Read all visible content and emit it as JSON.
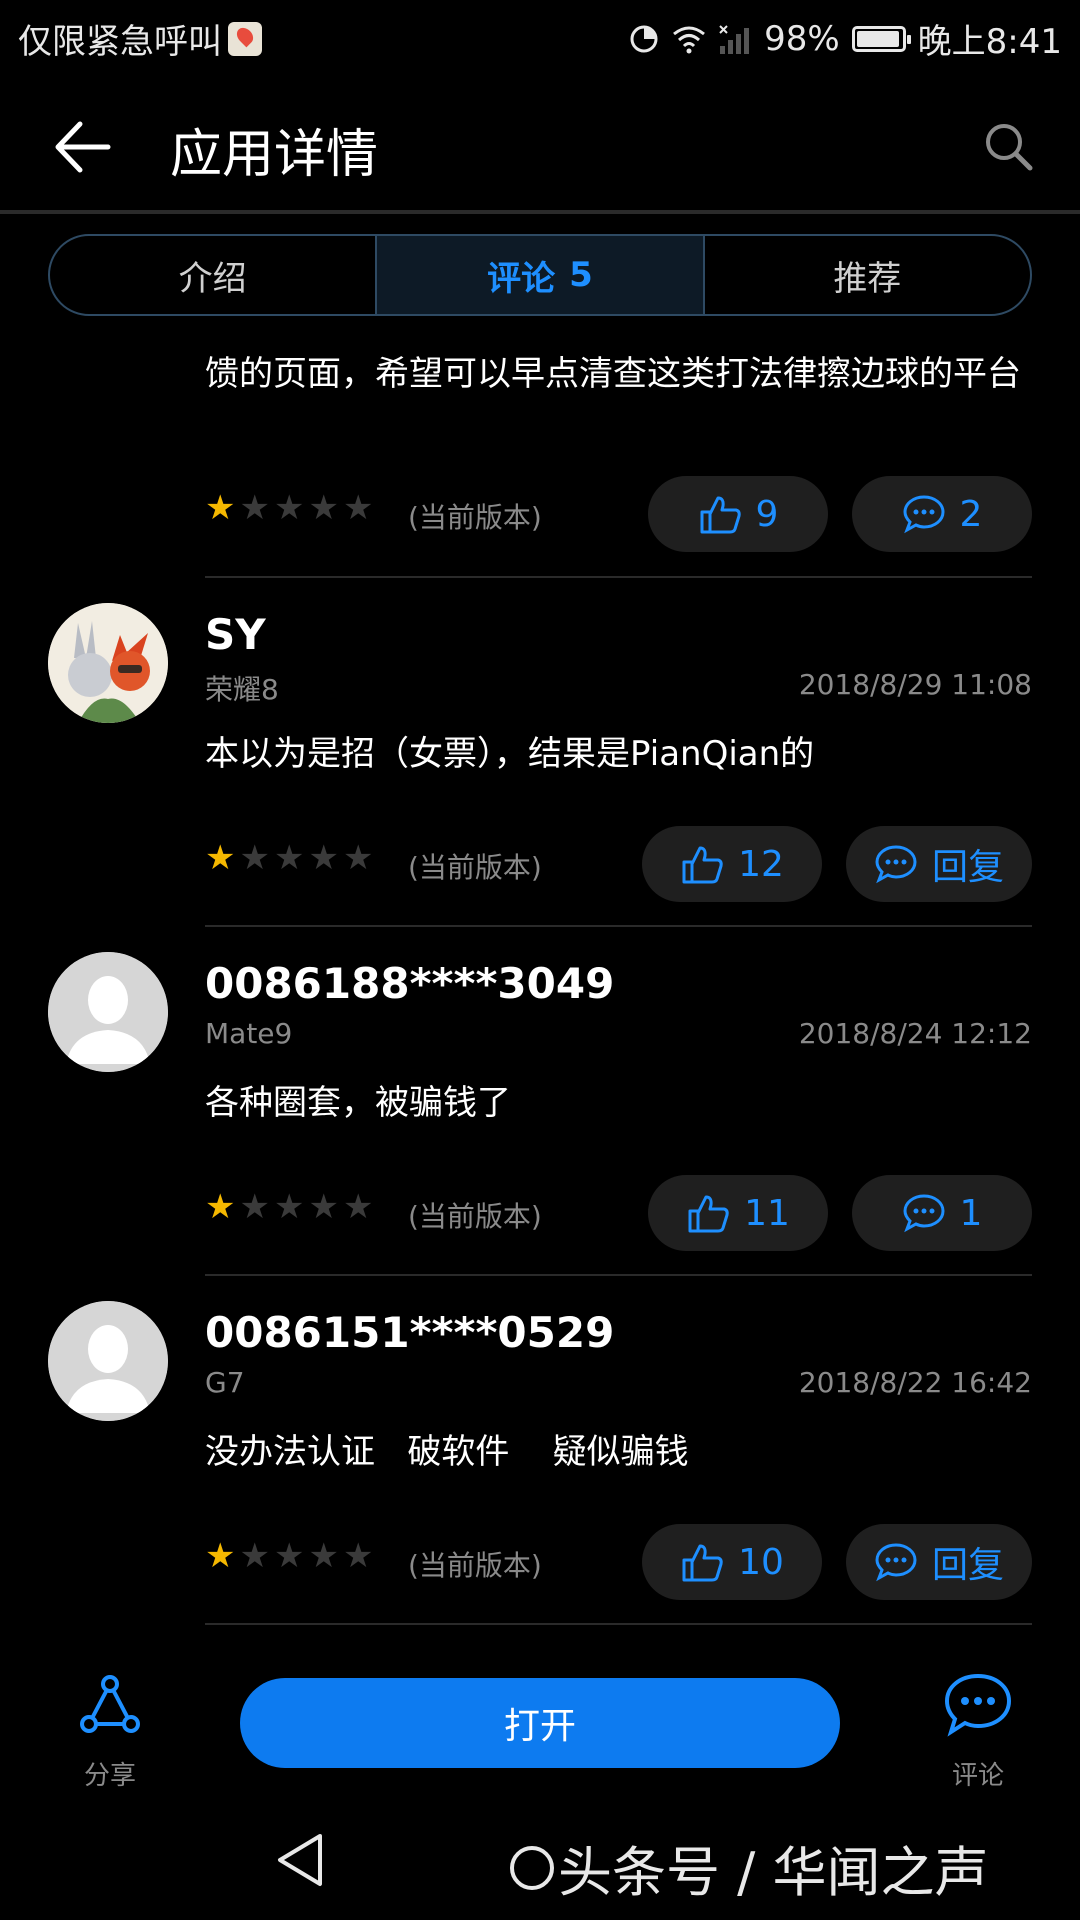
{
  "status_bar": {
    "left_text": "仅限紧急呼叫",
    "battery": "98%",
    "time": "晚上8:41"
  },
  "header": {
    "title": "应用详情"
  },
  "tabs": [
    {
      "label": "介绍",
      "count": ""
    },
    {
      "label": "评论",
      "count": "5"
    },
    {
      "label": "推荐",
      "count": ""
    }
  ],
  "reviews": [
    {
      "username": "",
      "device": "",
      "datetime": "",
      "content": "馈的页面，希望可以早点清查这类打法律擦边球的平台",
      "rating": 1,
      "version": "(当前版本)",
      "likes": "9",
      "reply": "2"
    },
    {
      "username": "SY",
      "device": "荣耀8",
      "datetime": "2018/8/29 11:08",
      "content": "本以为是招（女票），结果是PianQian的",
      "rating": 1,
      "version": "(当前版本)",
      "likes": "12",
      "reply": "回复"
    },
    {
      "username": "0086188****3049",
      "device": "Mate9",
      "datetime": "2018/8/24 12:12",
      "content": "各种圈套，被骗钱了",
      "rating": 1,
      "version": "(当前版本)",
      "likes": "11",
      "reply": "1"
    },
    {
      "username": "0086151****0529",
      "device": "G7",
      "datetime": "2018/8/22 16:42",
      "content": "没办法认证   破软件    疑似骗钱",
      "rating": 1,
      "version": "(当前版本)",
      "likes": "10",
      "reply": "回复"
    }
  ],
  "bottom_bar": {
    "share_label": "分享",
    "open_label": "打开",
    "comment_label": "评论"
  },
  "watermark": "头条号 / 华闻之声",
  "colors": {
    "accent": "#1e8fff",
    "star": "#f5b800",
    "background": "#000000",
    "open_button": "#0d7bf0"
  }
}
